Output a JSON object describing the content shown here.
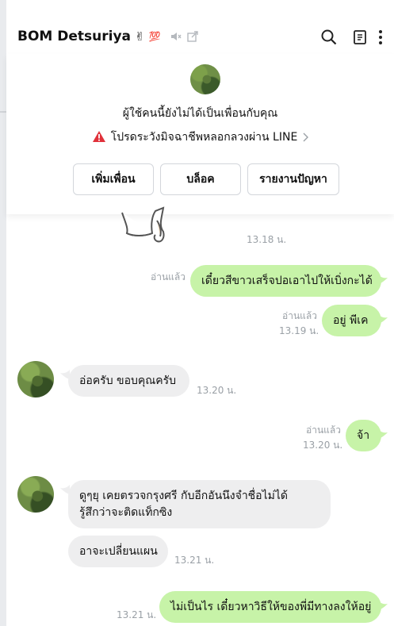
{
  "header": {
    "contact_name": "BOM Detsuriya",
    "emoji_1": "✌",
    "emoji_2": "💯",
    "icons": [
      "mute-speaker-icon",
      "external-window-icon",
      "search-icon",
      "notes-icon",
      "more-vertical-icon"
    ]
  },
  "panel": {
    "notice": "ผู้ใช้คนนี้ยังไม่ได้เป็นเพื่อนกับคุณ",
    "warning": "โปรดระวังมิจฉาชีพหลอกลวงผ่าน LINE",
    "buttons": {
      "add_friend": "เพิ่มเพื่อน",
      "block": "บล็อค",
      "report": "รายงานปัญหา"
    }
  },
  "messages": {
    "sticker_time": "13.18 น.",
    "m1": {
      "read": "อ่านแล้ว",
      "text": "เดี๋ยวสีขาวเสร็จปอเอาไปให้เบิ่งกะได้"
    },
    "m2": {
      "read": "อ่านแล้ว",
      "time": "13.19 น.",
      "text": "อยู่ พีเค"
    },
    "m3": {
      "text": "อ่อครับ ขอบคุณครับ",
      "time": "13.20 น."
    },
    "m4": {
      "read": "อ่านแล้ว",
      "time": "13.20 น.",
      "text": "จ้า"
    },
    "m5": {
      "line1": "ดูๆยุ  เคยตรวจกรุงศรี กับอีกอันนึงจำชื่อไม่ได้",
      "line2": "รู้สึกว่าจะติดแท็กซิง"
    },
    "m6": {
      "text": "อาจะเปลี่ยนแผน",
      "time": "13.21 น."
    },
    "m7": {
      "time": "13.21 น.",
      "text": "ไม่เป็นไร  เดี๋ยวหาวิธีให้ของพี่มีทางลงให้อยู่"
    }
  },
  "colors": {
    "outgoing_bubble": "#c7f3a8",
    "incoming_bubble": "#eeeeef",
    "warning_red": "#e0313a"
  }
}
